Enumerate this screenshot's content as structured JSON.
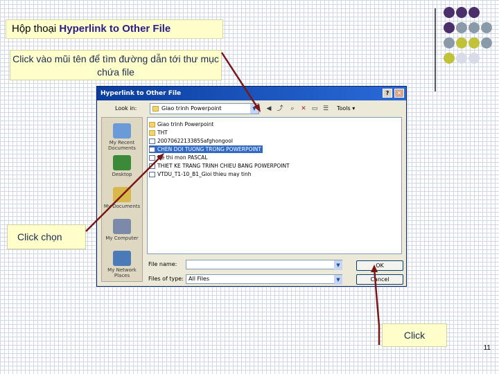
{
  "slide": {
    "title_prefix": "Hộp thoại ",
    "title_strong": "Hyperlink to Other File",
    "callout_browse": "Click vào mũi tên để tìm đường dẫn tới thư mục chứa file",
    "callout_select": "Click chọn",
    "callout_ok": "Click",
    "page_number": "11",
    "dot_colors": [
      "#4a2f6b",
      "#8a9aa8",
      "#c2c23a",
      "#d8dbe8"
    ]
  },
  "dialog": {
    "title": "Hyperlink to Other File",
    "help_button": "?",
    "close_button": "✕",
    "look_in_label": "Look in:",
    "look_in_value": "Giao trinh Powerpoint",
    "tools_label": "Tools",
    "places": [
      {
        "label": "My Recent Documents",
        "icon": "recent-docs-icon"
      },
      {
        "label": "Desktop",
        "icon": "desktop-icon"
      },
      {
        "label": "My Documents",
        "icon": "my-documents-icon"
      },
      {
        "label": "My Computer",
        "icon": "my-computer-icon"
      },
      {
        "label": "My Network Places",
        "icon": "network-places-icon"
      }
    ],
    "files": [
      {
        "name": "Giao trinh Powerpoint",
        "kind": "folder"
      },
      {
        "name": "THT",
        "kind": "folder"
      },
      {
        "name": "2007062213385Safghongool",
        "kind": "doc"
      },
      {
        "name": "CHEN DOI TUONG TRONG POWERPOINT",
        "kind": "doc"
      },
      {
        "name": "De thi mon PASCAL",
        "kind": "doc"
      },
      {
        "name": "THIET KE TRANG TRINH CHIEU BANG POWERPOINT",
        "kind": "doc"
      },
      {
        "name": "VTDU_T1-10_B1_Gioi thieu may tinh",
        "kind": "doc"
      }
    ],
    "file_name_label": "File name:",
    "file_name_value": "",
    "file_type_label": "Files of type:",
    "file_type_value": "All Files",
    "ok_label": "OK",
    "cancel_label": "Cancel"
  }
}
